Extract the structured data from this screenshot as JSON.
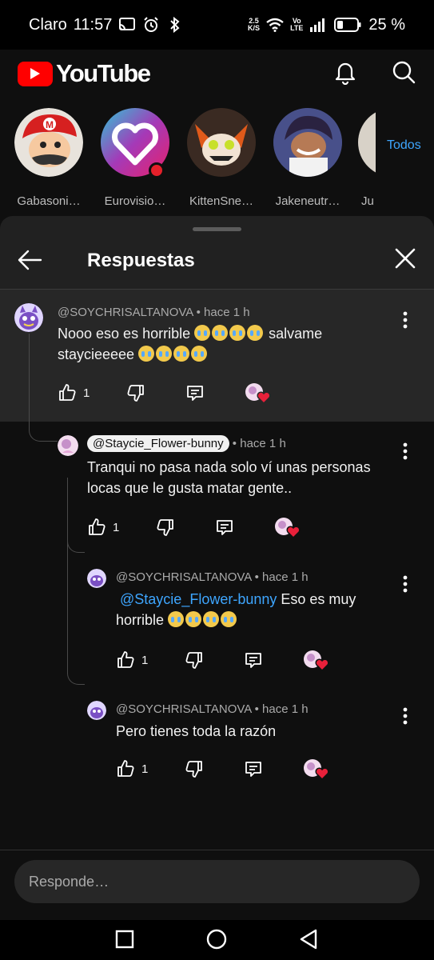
{
  "status_bar": {
    "carrier": "Claro",
    "time": "11:57",
    "net_speed_top": "2.5",
    "net_speed_bottom": "K/S",
    "volte_top": "Vo",
    "volte_bottom": "LTE",
    "battery": "25 %"
  },
  "header": {
    "logo_text": "YouTube",
    "icons": [
      "bell-icon",
      "search-icon"
    ]
  },
  "stories": {
    "items": [
      {
        "label": "Gabasoni…"
      },
      {
        "label": "Eurovisio…"
      },
      {
        "label": "KittenSne…"
      },
      {
        "label": "Jakeneutr…"
      },
      {
        "label": "Ju"
      }
    ],
    "all_label": "Todos"
  },
  "sheet": {
    "title": "Respuestas"
  },
  "comments": [
    {
      "author": "@SOYCHRISALTANOVA",
      "time": "hace 1 h",
      "text_line1": "Nooo eso es horrible",
      "text_line1_after": "salvame",
      "text_line2": "staycieeeee",
      "likes": "1"
    },
    {
      "author": "@Staycie_Flower-bunny",
      "time": "hace 1 h",
      "text_line1": "Tranqui no pasa nada solo ví unas personas",
      "text_line2": "locas que le gusta matar gente..",
      "likes": "1"
    },
    {
      "author": "@SOYCHRISALTANOVA",
      "time": "hace 1 h",
      "mention": "@Staycie_Flower-bunny",
      "text_line1": " Eso es muy",
      "text_line2": "horrible",
      "likes": "1"
    },
    {
      "author": "@SOYCHRISALTANOVA",
      "time": "hace 1 h",
      "text_line1": "Pero tienes toda la razón",
      "likes": "1"
    }
  ],
  "reply": {
    "placeholder": "Responde…"
  },
  "colors": {
    "accent_red": "#ff0000",
    "link_blue": "#3ea6ff",
    "background": "#0f0f0f",
    "sheet": "#212121"
  }
}
